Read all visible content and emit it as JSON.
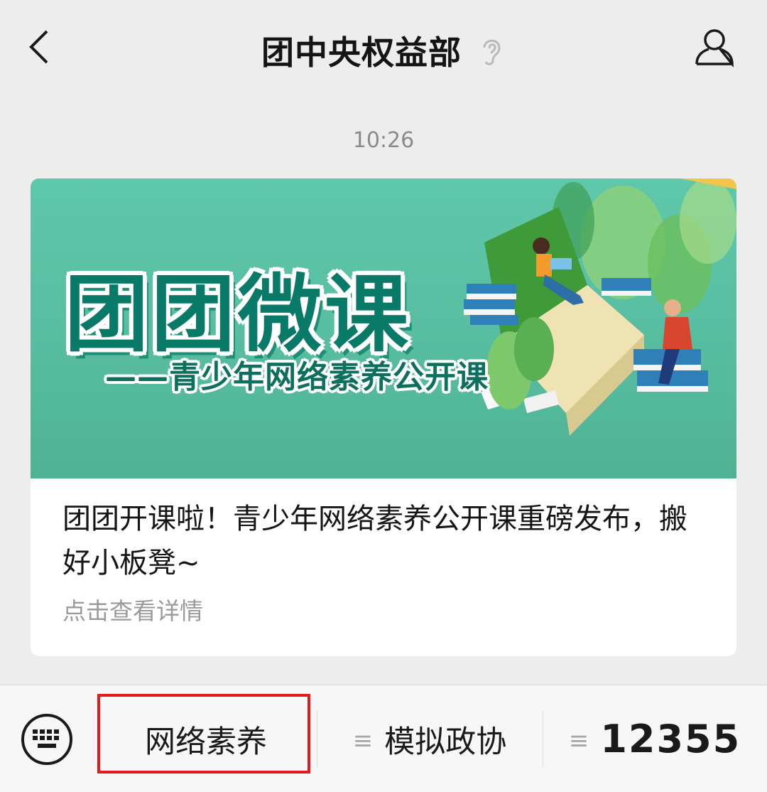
{
  "header": {
    "title": "团中央权益部"
  },
  "chat": {
    "timestamp": "10:26",
    "article": {
      "banner_title": "团团微课",
      "banner_subtitle": "——青少年网络素养公开课",
      "title": "团团开课啦！青少年网络素养公开课重磅发布，搬好小板凳~",
      "link_text": "点击查看详情"
    }
  },
  "bottom_menu": {
    "items": [
      {
        "label": "网络素养",
        "has_list_icon": false
      },
      {
        "label": "模拟政协",
        "has_list_icon": true
      },
      {
        "label": "12355",
        "has_list_icon": true
      }
    ]
  },
  "colors": {
    "highlight_border": "#e41b1b",
    "banner_green": "#58bda0"
  },
  "icons": [
    "back-chevron-icon",
    "ear-icon",
    "person-icon",
    "keyboard-icon",
    "list-icon"
  ]
}
